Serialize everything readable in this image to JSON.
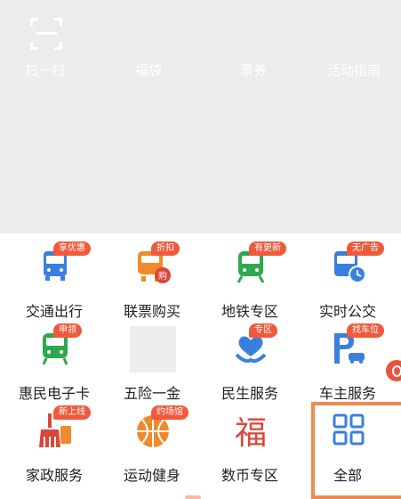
{
  "header": {
    "nav": [
      "扫一扫",
      "福袋",
      "票券",
      "活动指南"
    ]
  },
  "services": [
    {
      "label": "交通出行",
      "badge": "享优惠",
      "icon": "bus-icon"
    },
    {
      "label": "联票购买",
      "badge": "折扣",
      "icon": "train-ticket-icon"
    },
    {
      "label": "地铁专区",
      "badge": "有更新",
      "icon": "subway-icon"
    },
    {
      "label": "实时公交",
      "badge": "无广告",
      "icon": "realtime-bus-icon"
    },
    {
      "label": "惠民电子卡",
      "badge": "申领",
      "icon": "transit-card-icon"
    },
    {
      "label": "五险一金",
      "badge": "",
      "icon": "insurance-placeholder-icon"
    },
    {
      "label": "民生服务",
      "badge": "专区",
      "icon": "heart-hand-icon"
    },
    {
      "label": "车主服务",
      "badge": "找车位",
      "icon": "parking-car-icon"
    },
    {
      "label": "家政服务",
      "badge": "新上线",
      "icon": "broom-icon"
    },
    {
      "label": "运动健身",
      "badge": "约场馆",
      "icon": "basketball-icon"
    },
    {
      "label": "数币专区",
      "badge": "",
      "icon": "fortune-icon"
    },
    {
      "label": "全部",
      "badge": "",
      "icon": "grid-apps-icon"
    }
  ],
  "colors": {
    "blue": "#3a7fe0",
    "orange": "#f08a2a",
    "green": "#2fa84f",
    "red": "#d9473a",
    "badge": "#f05a3c",
    "highlight": "#ef8a52"
  }
}
